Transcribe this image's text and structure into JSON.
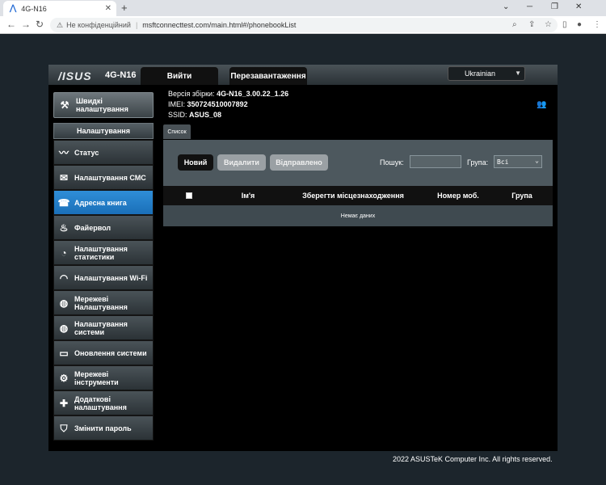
{
  "browser": {
    "tab_title": "4G-N16",
    "tab_logo": "asus-icon",
    "new_tab": "+",
    "not_secure": "Не конфіденційний",
    "url": "msftconnecttest.com/main.html#/phonebookList"
  },
  "router": {
    "brand": "/ISUS",
    "model": "4G-N16",
    "logout_label": "Вийти",
    "reboot_label": "Перезавантаження",
    "language": "Ukrainian",
    "firmware_label": "Версія збірки:",
    "firmware_value": "4G-N16_3.00.22_1.26",
    "imei_label": "IMEI:",
    "imei_value": "350724510007892",
    "ssid_label": "SSID:",
    "ssid_value": "ASUS_08"
  },
  "sidebar": {
    "quick_setup": "Швидкі налаштування",
    "menu_title": "Налаштування",
    "items": [
      {
        "label": "Статус",
        "icon": "pulse-icon",
        "active": false
      },
      {
        "label": "Налаштування СМС",
        "icon": "sms-icon",
        "active": false
      },
      {
        "label": "Адресна книга",
        "icon": "phonebook-icon",
        "active": true
      },
      {
        "label": "Файервол",
        "icon": "firewall-icon",
        "active": false
      },
      {
        "label": "Налаштування статистики",
        "icon": "gauge-icon",
        "active": false
      },
      {
        "label": "Налаштування Wi-Fi",
        "icon": "wifi-icon",
        "active": false
      },
      {
        "label": "Мережеві Налаштування",
        "icon": "globe-icon",
        "active": false
      },
      {
        "label": "Налаштування системи",
        "icon": "globe-icon",
        "active": false
      },
      {
        "label": "Оновлення системи",
        "icon": "monitor-icon",
        "active": false
      },
      {
        "label": "Мережеві інструменти",
        "icon": "gear-icon",
        "active": false
      },
      {
        "label": "Додаткові налаштування",
        "icon": "advanced-icon",
        "active": false
      },
      {
        "label": "Змінити пароль",
        "icon": "lock-icon",
        "active": false
      }
    ]
  },
  "phonebook": {
    "tab_label": "Список",
    "new_label": "Новий",
    "delete_label": "Видалити",
    "sent_label": "Відправлено",
    "search_label": "Пошук:",
    "search_value": "",
    "group_label": "Група:",
    "group_value": "Всі",
    "columns": [
      "Ім'я",
      "Зберегти місцезнаходження",
      "Номер моб.",
      "Група"
    ],
    "empty_text": "Немає даних"
  },
  "footer": {
    "copyright": "2022 ASUSTeK Computer Inc. All rights reserved."
  }
}
